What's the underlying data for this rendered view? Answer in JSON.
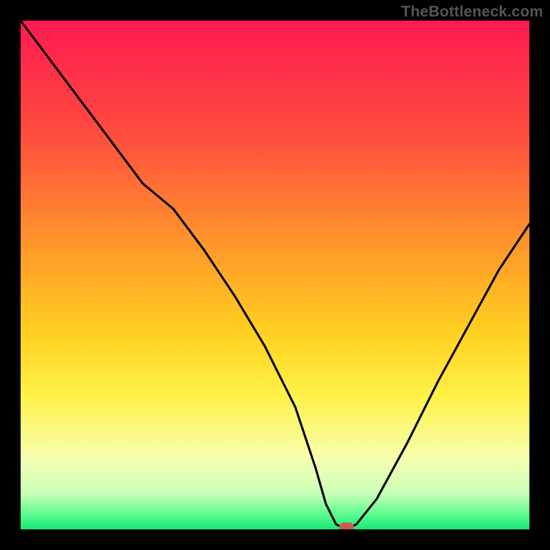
{
  "watermark": "TheBottleneck.com",
  "colors": {
    "black": "#000000",
    "curve": "#000000",
    "marker": "#c85a54",
    "gradient_stops": [
      {
        "pct": 0,
        "color": "#ff1a52"
      },
      {
        "pct": 22,
        "color": "#ff4b3e"
      },
      {
        "pct": 45,
        "color": "#ff9a2a"
      },
      {
        "pct": 62,
        "color": "#ffd21f"
      },
      {
        "pct": 74,
        "color": "#fff24a"
      },
      {
        "pct": 86,
        "color": "#f6ffb0"
      },
      {
        "pct": 93,
        "color": "#c8ffb8"
      },
      {
        "pct": 97,
        "color": "#5dfb8f"
      },
      {
        "pct": 100,
        "color": "#18e877"
      }
    ]
  },
  "chart_data": {
    "type": "line",
    "title": "",
    "xlabel": "",
    "ylabel": "",
    "xlim": [
      0,
      100
    ],
    "ylim": [
      0,
      100
    ],
    "grid": false,
    "legend": false,
    "series": [
      {
        "name": "bottleneck-curve",
        "x": [
          0,
          6,
          12,
          18,
          24,
          30,
          36,
          42,
          48,
          54,
          58,
          60,
          62,
          64,
          66,
          70,
          76,
          82,
          88,
          94,
          100
        ],
        "y": [
          100,
          92,
          84,
          76,
          68,
          63,
          55,
          46,
          36,
          24,
          12,
          5,
          1,
          0,
          1,
          6,
          17,
          29,
          40,
          51,
          60
        ]
      }
    ],
    "marker": {
      "x": 64,
      "y": 0
    },
    "annotations": []
  }
}
